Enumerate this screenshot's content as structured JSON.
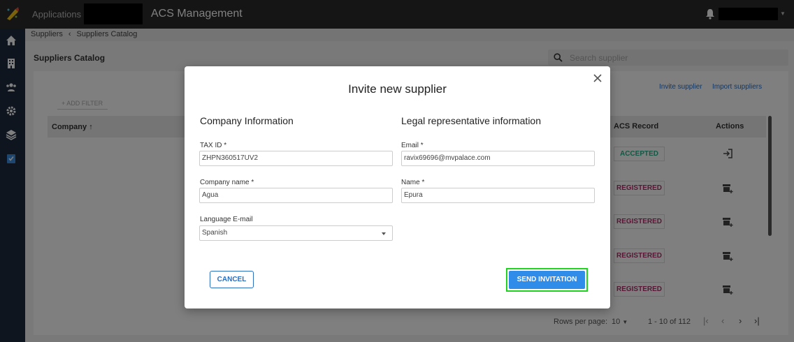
{
  "topbar": {
    "apps_label": "Applications",
    "app_title": "ACS Management"
  },
  "breadcrumb": {
    "root": "Suppliers",
    "separator": "‹",
    "current": "Suppliers Catalog"
  },
  "page": {
    "heading": "Suppliers Catalog",
    "search_placeholder": "Search supplier",
    "invite_link": "Invite supplier",
    "import_link": "Import suppliers",
    "add_filter": "ADD FILTER",
    "columns": {
      "company": "Company",
      "acs_record": "ACS Record",
      "actions": "Actions"
    },
    "rows": [
      {
        "status": "ACCEPTED",
        "action_icon": "login-icon"
      },
      {
        "status": "REGISTERED",
        "action_icon": "store-add-icon"
      },
      {
        "status": "REGISTERED",
        "action_icon": "store-add-icon"
      },
      {
        "status": "REGISTERED",
        "action_icon": "store-add-icon"
      },
      {
        "status": "REGISTERED",
        "action_icon": "store-add-icon"
      }
    ],
    "pagination": {
      "rows_per_page_label": "Rows per page:",
      "rows_per_page": "10",
      "range": "1 - 10 of 112"
    }
  },
  "modal": {
    "title": "Invite new supplier",
    "company_section": "Company Information",
    "legal_section": "Legal representative information",
    "tax_id_label": "TAX ID *",
    "tax_id_value": "ZHPN360517UV2",
    "company_name_label": "Company name *",
    "company_name_value": "Agua",
    "language_label": "Language E-mail",
    "language_value": "Spanish",
    "email_label": "Email *",
    "email_value": "ravix69696@mvpalace.com",
    "name_label": "Name *",
    "name_value": "Epura",
    "cancel_label": "CANCEL",
    "send_label": "SEND INVITATION"
  },
  "colors": {
    "accent": "#2f8ce9",
    "highlight": "#21d321",
    "accepted": "#27b08a",
    "registered": "#b0316a"
  }
}
